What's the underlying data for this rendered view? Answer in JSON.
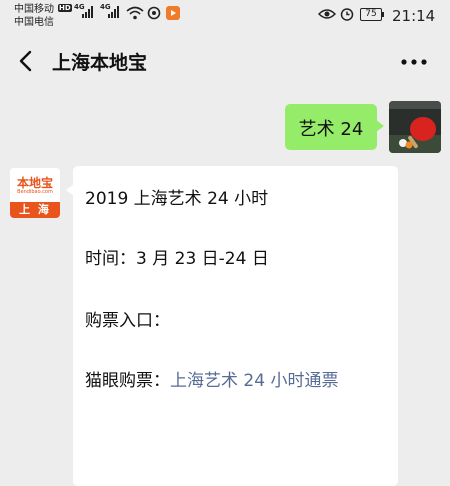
{
  "status_bar": {
    "carrier_1": "中国移动",
    "carrier_2": "中国电信",
    "hd_badge": "HD",
    "network_1": "4G",
    "network_2": "4G",
    "battery_level": "75",
    "time": "21:14",
    "icons": [
      "signal-icon",
      "wifi-icon",
      "sync-icon",
      "video-app-icon",
      "eye-icon",
      "alarm-icon",
      "battery-icon"
    ]
  },
  "nav": {
    "title": "上海本地宝",
    "back_icon": "chevron-left-icon",
    "more_icon": "more-dots-icon"
  },
  "messages": {
    "user_message": "艺术 24",
    "bot_avatar": {
      "logo_text": "本地宝",
      "logo_subtext": "Bendibao.com",
      "city": "上 海",
      "brand_color": "#e8541b"
    },
    "bot_lines": [
      "2019 上海艺术 24 小时",
      "时间：3 月 23 日-24 日",
      "购票入口："
    ],
    "ticket_prefix": "猫眼购票：",
    "ticket_link": "上海艺术 24 小时通票"
  },
  "colors": {
    "background": "#ededed",
    "user_bubble": "#95ec69",
    "link": "#576b95"
  }
}
